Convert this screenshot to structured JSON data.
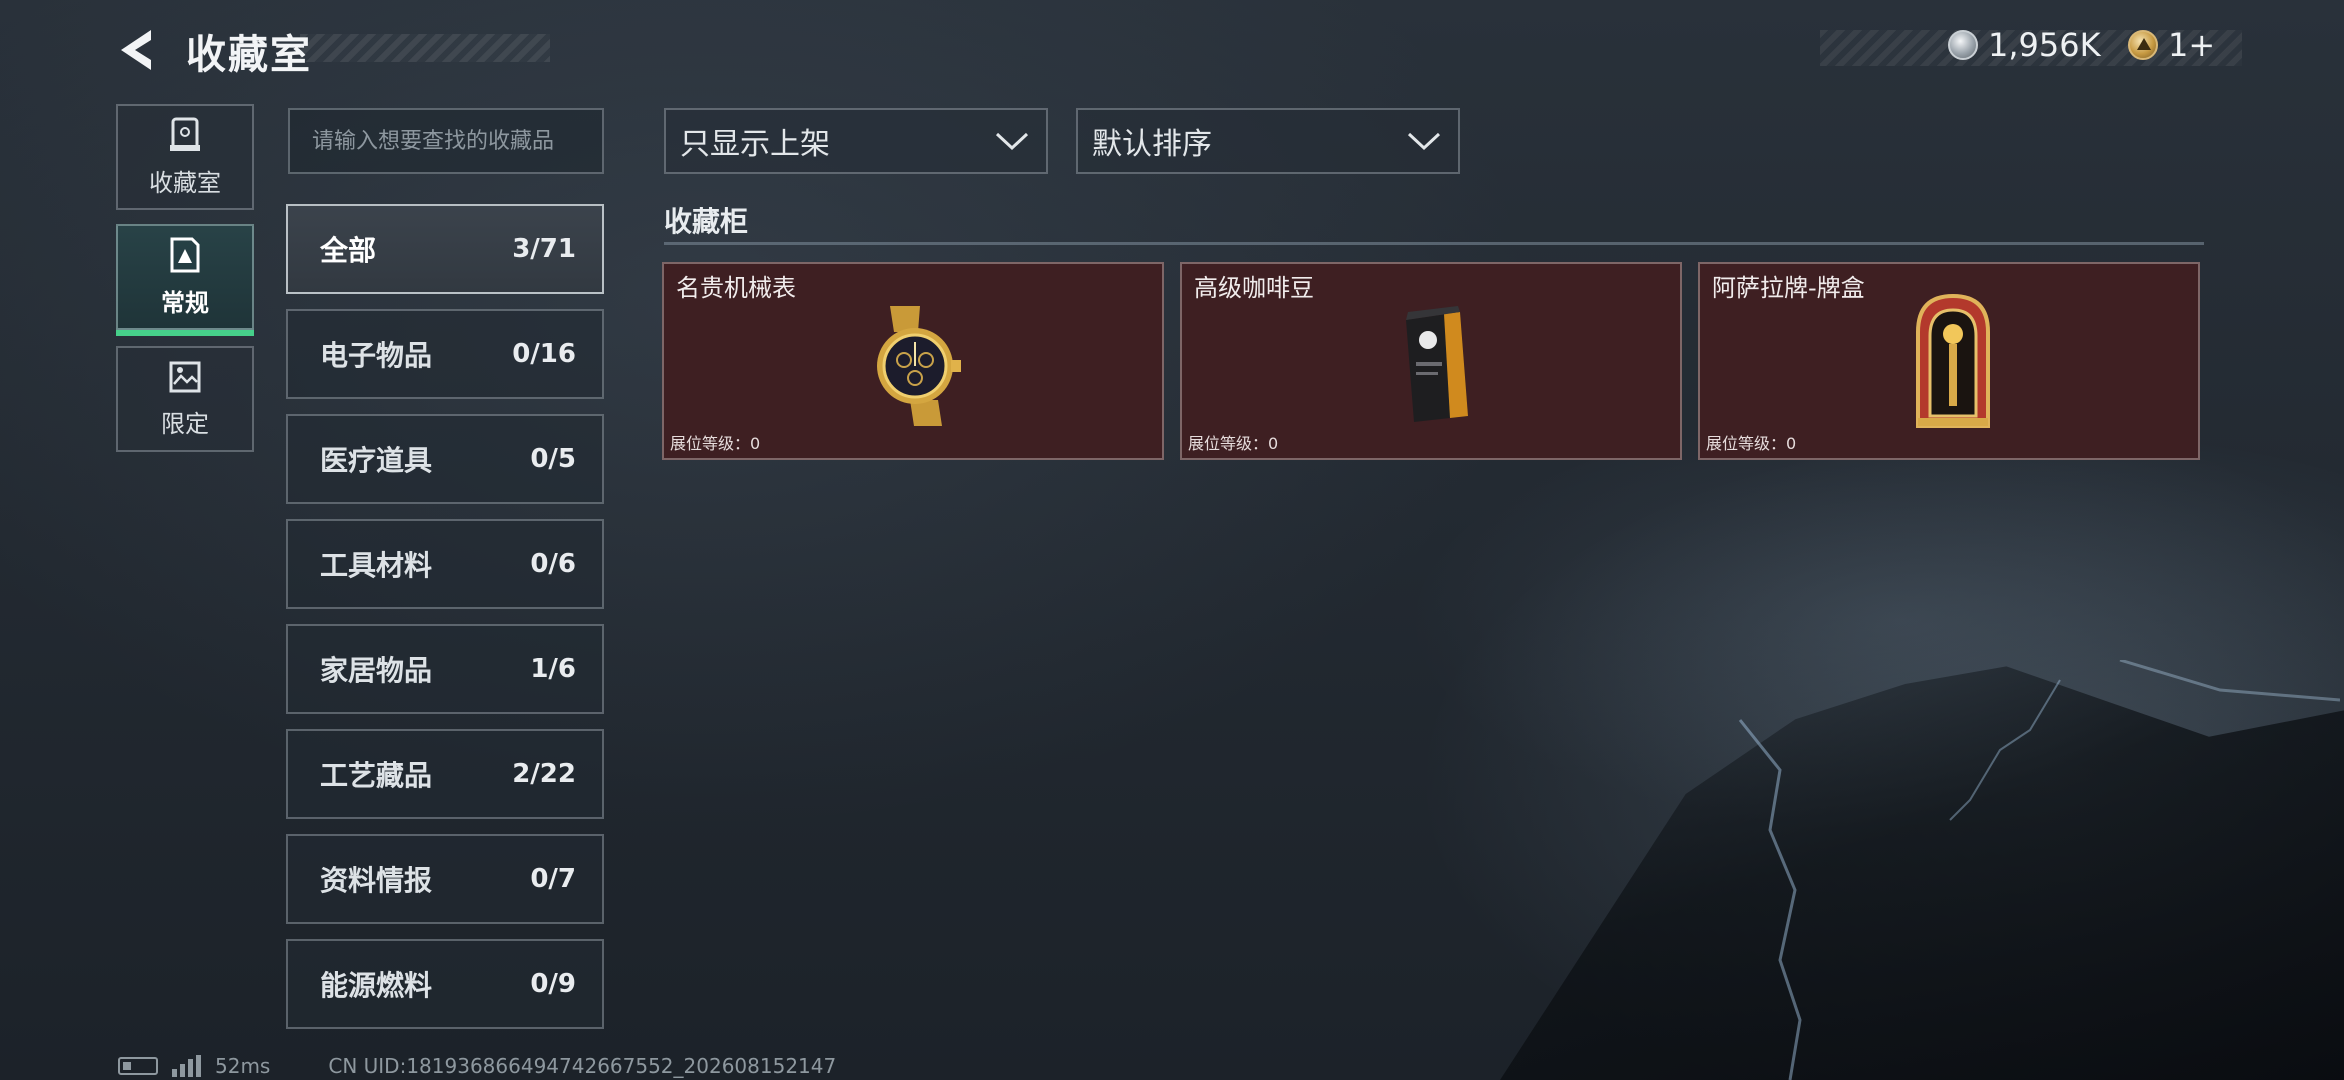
{
  "header": {
    "title": "收藏室",
    "currency_silver": "1,956K",
    "currency_gold": "1+"
  },
  "side_tabs": [
    {
      "label": "收藏室",
      "icon": "collection-room-icon",
      "active": false
    },
    {
      "label": "常规",
      "icon": "regular-icon",
      "active": true
    },
    {
      "label": "限定",
      "icon": "limited-icon",
      "active": false
    }
  ],
  "search": {
    "placeholder": "请输入想要查找的收藏品",
    "value": ""
  },
  "filters": {
    "display_filter": "只显示上架",
    "sort": "默认排序"
  },
  "categories": [
    {
      "label": "全部",
      "count": "3/71",
      "active": true
    },
    {
      "label": "电子物品",
      "count": "0/16"
    },
    {
      "label": "医疗道具",
      "count": "0/5"
    },
    {
      "label": "工具材料",
      "count": "0/6"
    },
    {
      "label": "家居物品",
      "count": "1/6"
    },
    {
      "label": "工艺藏品",
      "count": "2/22"
    },
    {
      "label": "资料情报",
      "count": "0/7"
    },
    {
      "label": "能源燃料",
      "count": "0/9"
    }
  ],
  "cabinet": {
    "title": "收藏柜",
    "items": [
      {
        "name": "名贵机械表",
        "level": "展位等级：0",
        "image": "gold-watch"
      },
      {
        "name": "高级咖啡豆",
        "level": "展位等级：0",
        "image": "coffee-bag"
      },
      {
        "name": "阿萨拉牌-牌盒",
        "level": "展位等级：0",
        "image": "card-box"
      }
    ]
  },
  "footer": {
    "ping": "52ms",
    "uid": "CN UID:181936866494742667552_202608152147"
  },
  "colors": {
    "accent_green": "#46d08a",
    "card_bg": "#3e1f22",
    "background": "#232a32"
  }
}
